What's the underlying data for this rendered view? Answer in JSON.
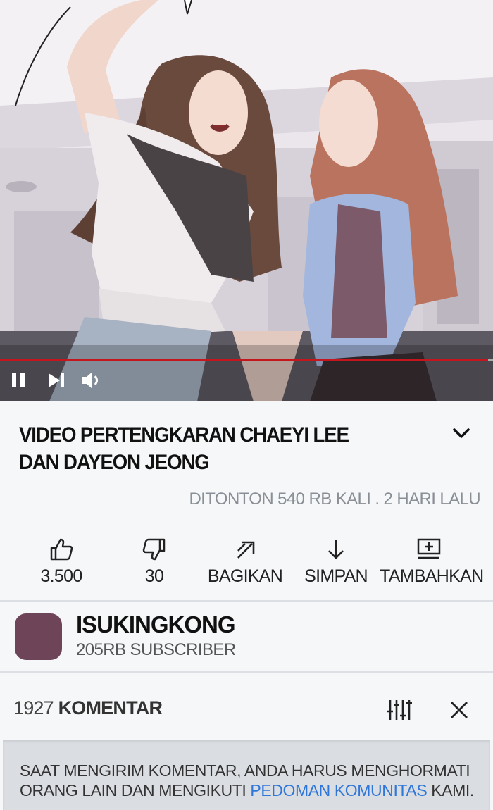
{
  "video": {
    "progress_fraction": 0.99,
    "controls": {
      "pause_icon": "pause-icon",
      "next_icon": "next-icon",
      "volume_icon": "volume-icon"
    },
    "progress_color": "#c4161c"
  },
  "info": {
    "title": "VIDEO PERTENGKARAN CHAEYI LEE DAN DAYEON JEONG",
    "expand_icon": "chevron-down-icon",
    "views": "DITONTON 540 RB KALI . 2 HARI LALU"
  },
  "actions": [
    {
      "icon": "thumbs-up-icon",
      "label": "3.500"
    },
    {
      "icon": "thumbs-down-icon",
      "label": "30"
    },
    {
      "icon": "share-icon",
      "label": "BAGIKAN"
    },
    {
      "icon": "save-icon",
      "label": "SIMPAN"
    },
    {
      "icon": "add-to-playlist-icon",
      "label": "TAMBAHKAN"
    }
  ],
  "channel": {
    "name": "ISUKINGKONG",
    "subscribers": "205RB SUBSCRIBER",
    "avatar_color": "#6e4558"
  },
  "comments": {
    "count": "1927",
    "label": "KOMENTAR",
    "filter_icon": "filter-sliders-icon",
    "close_icon": "close-icon"
  },
  "notice": {
    "text_before": "SAAT MENGIRIM KOMENTAR, ANDA HARUS MENGHORMATI ORANG LAIN DAN MENGIKUTI ",
    "link": "PEDOMAN KOMUNITAS",
    "text_after": " KAMI.",
    "link_color": "#2f76d9"
  }
}
